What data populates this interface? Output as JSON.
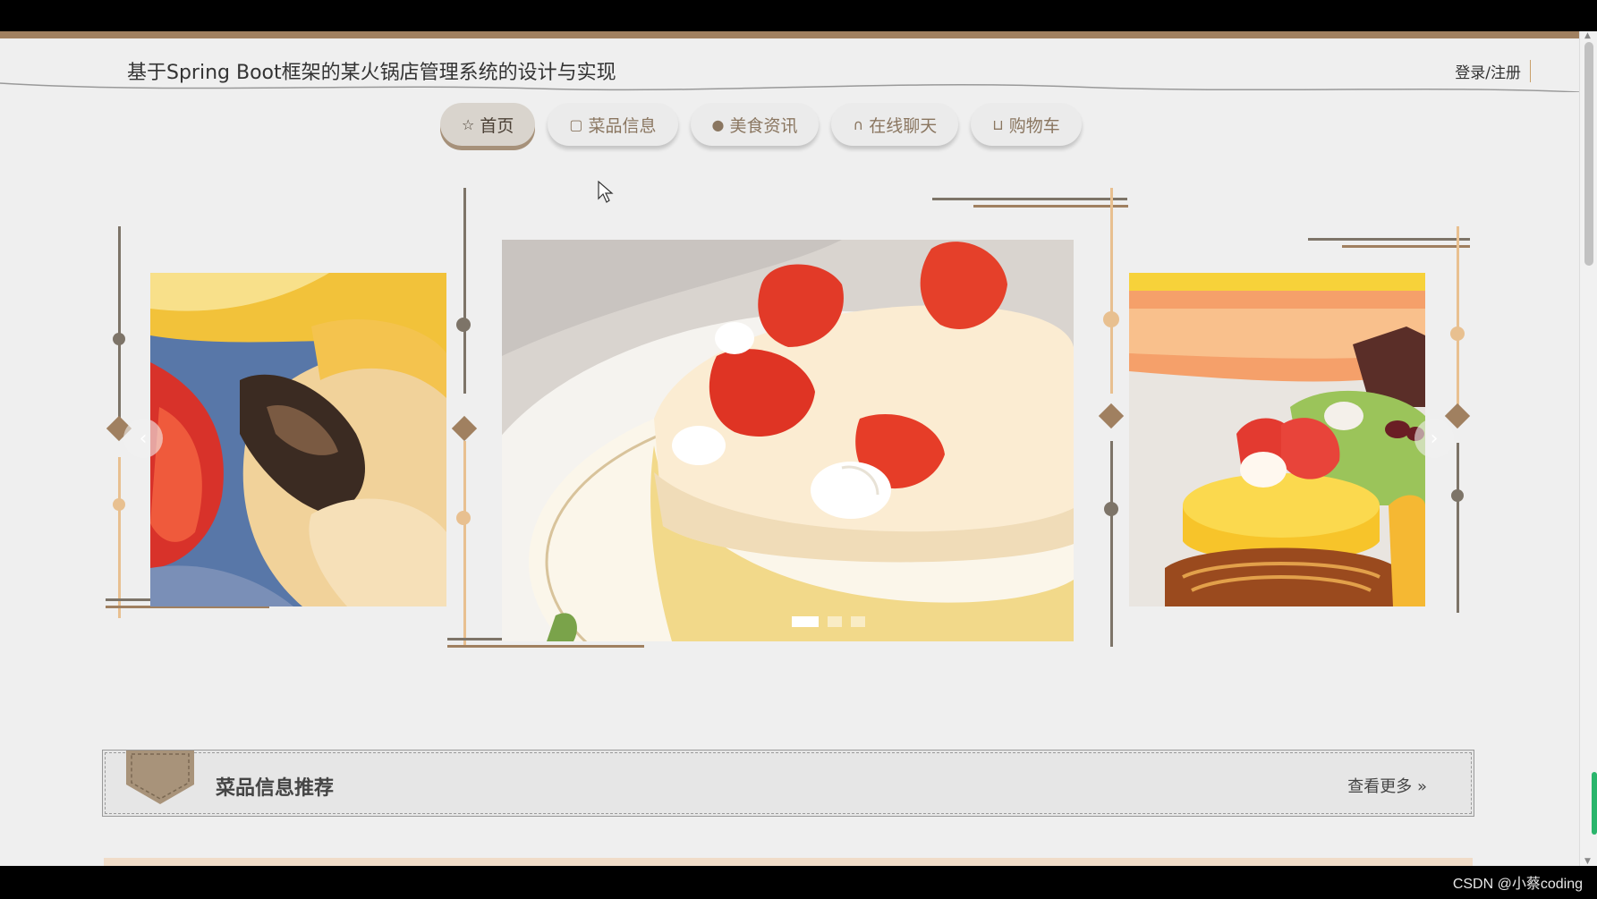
{
  "header": {
    "site_title": "基于Spring Boot框架的某火锅店管理系统的设计与实现",
    "login_label": "登录/注册"
  },
  "nav": {
    "items": [
      {
        "label": "首页",
        "icon": "star-icon",
        "active": true
      },
      {
        "label": "菜品信息",
        "icon": "bag-icon",
        "active": false
      },
      {
        "label": "美食资讯",
        "icon": "info-icon",
        "active": false
      },
      {
        "label": "在线聊天",
        "icon": "headset-icon",
        "active": false
      },
      {
        "label": "购物车",
        "icon": "cart-icon",
        "active": false
      }
    ]
  },
  "carousel": {
    "slides": [
      {
        "label": "slide-left",
        "subject": "pastry-with-tomato"
      },
      {
        "label": "slide-center",
        "subject": "strawberry-cream-cake"
      },
      {
        "label": "slide-right",
        "subject": "fruit-tarts"
      }
    ],
    "indicator_count": 3,
    "active_indicator": 0
  },
  "section": {
    "title": "菜品信息推荐",
    "more_label": "查看更多"
  },
  "colors": {
    "accent_brown": "#a08060",
    "accent_gold": "#e8c090",
    "deco_gray": "#7d7468"
  },
  "watermark": "CSDN @小蔡coding"
}
